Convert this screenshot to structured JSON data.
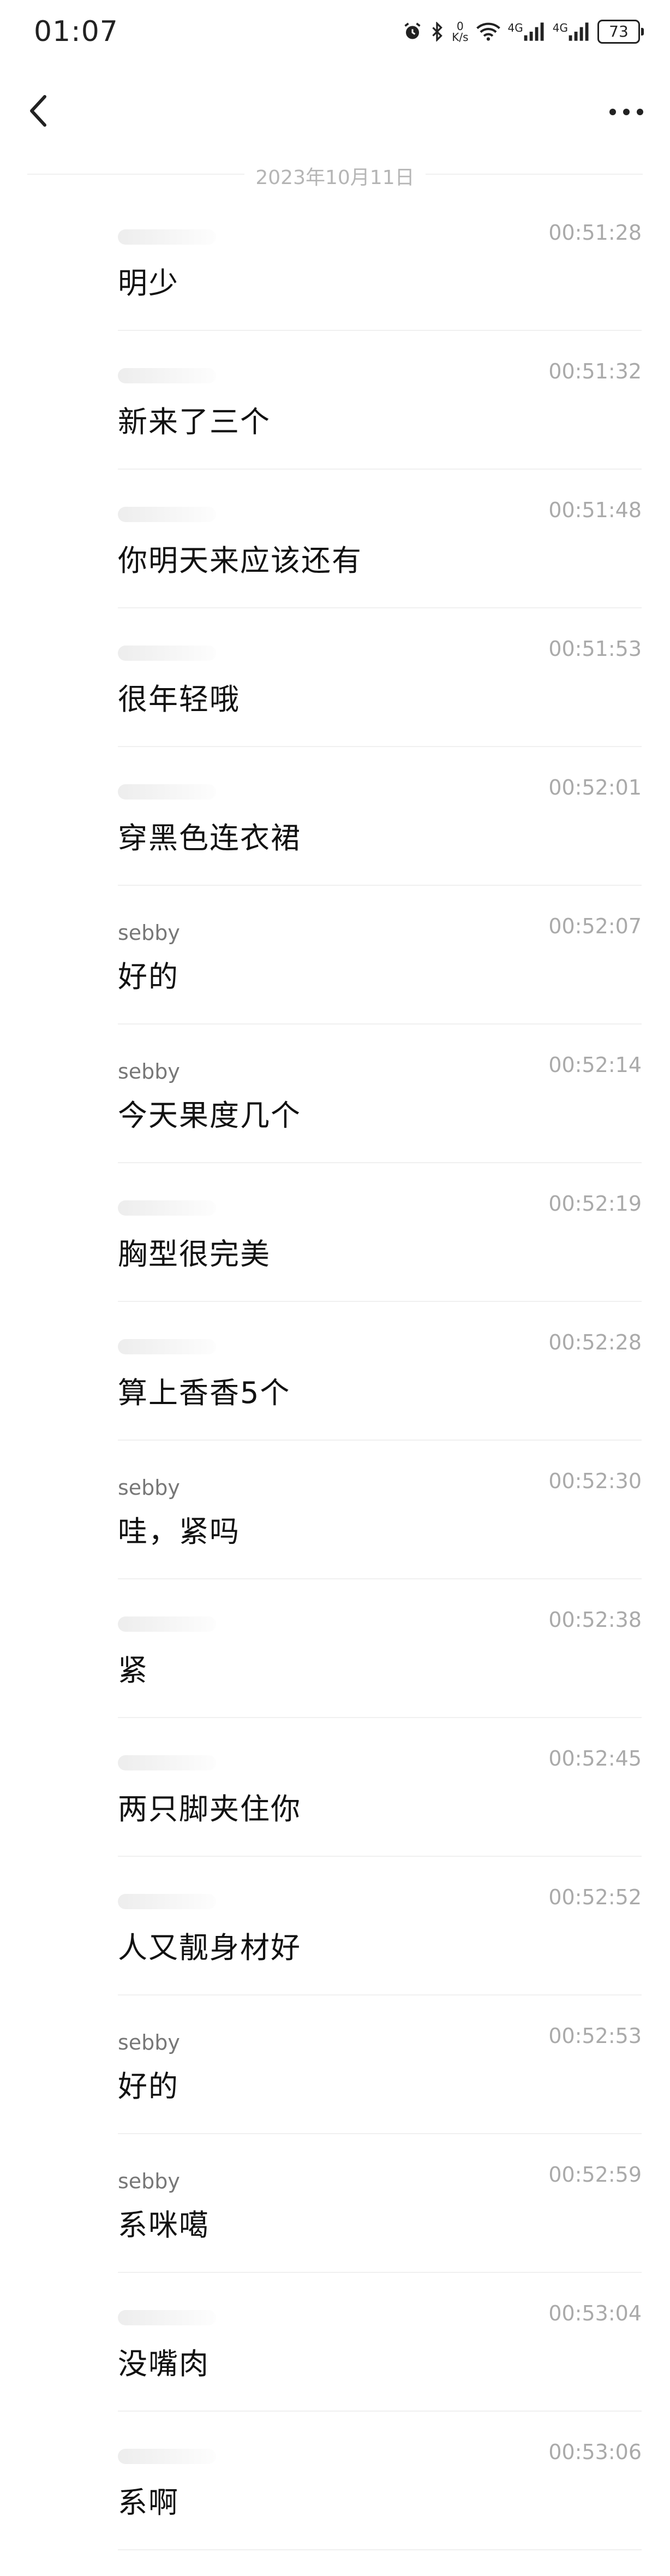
{
  "status_bar": {
    "time": "01:07",
    "net_speed_value": "0",
    "net_speed_unit": "K/s",
    "signal_label_1": "4G",
    "signal_label_2": "4G",
    "battery": "73"
  },
  "header": {
    "back_icon": "chevron-left-icon",
    "more_icon": "more-dots-icon"
  },
  "date": "2023年10月11日",
  "messages": [
    {
      "sender": "",
      "time": "00:51:28",
      "text": "明少"
    },
    {
      "sender": "",
      "time": "00:51:32",
      "text": "新来了三个"
    },
    {
      "sender": "",
      "time": "00:51:48",
      "text": "你明天来应该还有"
    },
    {
      "sender": "",
      "time": "00:51:53",
      "text": "很年轻哦"
    },
    {
      "sender": "",
      "time": "00:52:01",
      "text": "穿黑色连衣裙"
    },
    {
      "sender": "sebby",
      "time": "00:52:07",
      "text": "好的"
    },
    {
      "sender": "sebby",
      "time": "00:52:14",
      "text": "今天果度几个"
    },
    {
      "sender": "",
      "time": "00:52:19",
      "text": "胸型很完美"
    },
    {
      "sender": "",
      "time": "00:52:28",
      "text": "算上香香5个"
    },
    {
      "sender": "sebby",
      "time": "00:52:30",
      "text": "哇，紧吗"
    },
    {
      "sender": "",
      "time": "00:52:38",
      "text": "紧"
    },
    {
      "sender": "",
      "time": "00:52:45",
      "text": "两只脚夹住你"
    },
    {
      "sender": "",
      "time": "00:52:52",
      "text": "人又靓身材好"
    },
    {
      "sender": "sebby",
      "time": "00:52:53",
      "text": "好的"
    },
    {
      "sender": "sebby",
      "time": "00:52:59",
      "text": "系咪噶"
    },
    {
      "sender": "",
      "time": "00:53:04",
      "text": "没嘴肉"
    },
    {
      "sender": "",
      "time": "00:53:06",
      "text": "系啊"
    }
  ]
}
